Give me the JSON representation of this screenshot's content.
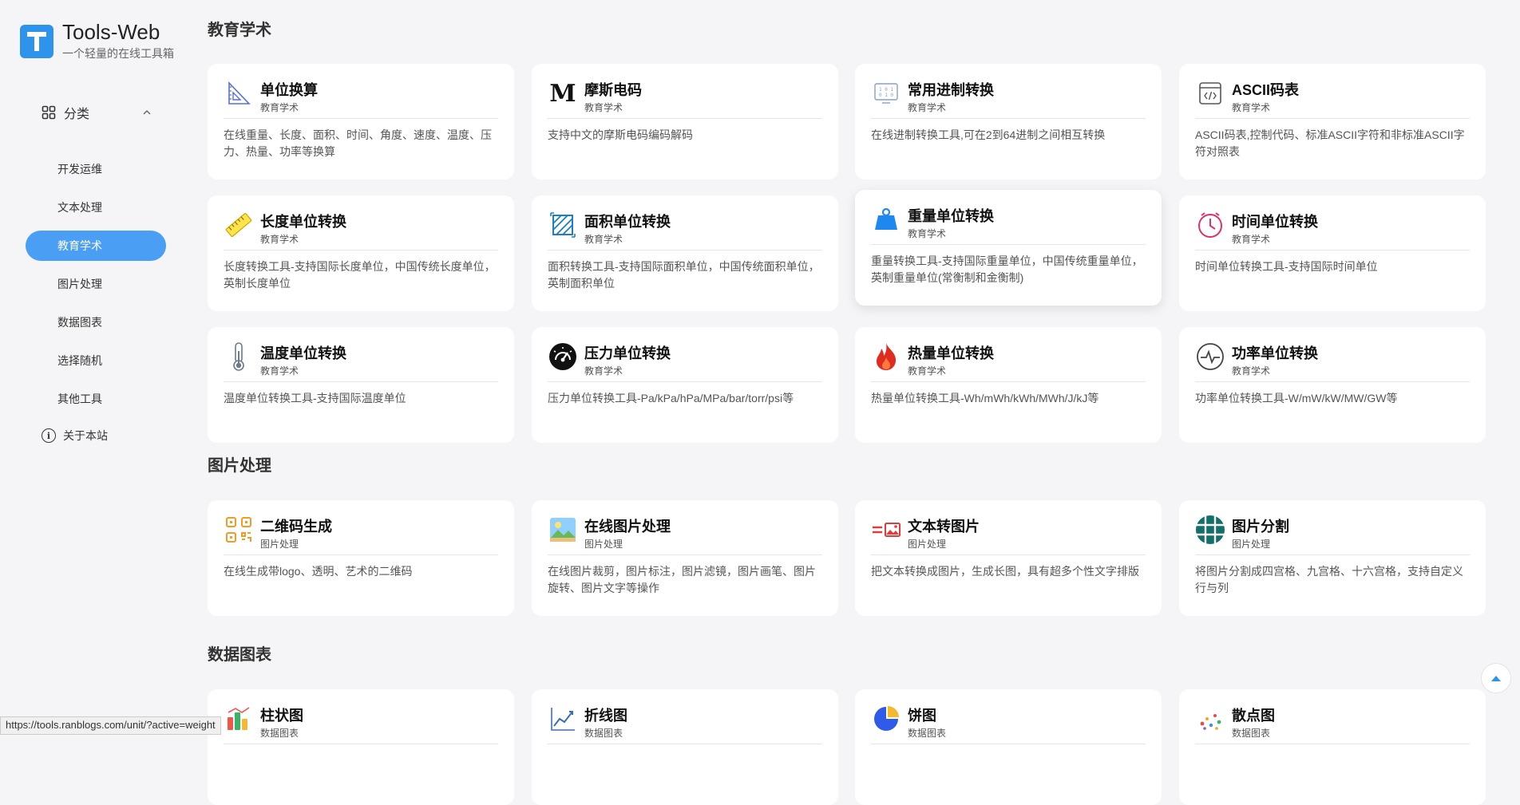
{
  "brand": {
    "name": "Tools-Web",
    "subtitle": "一个轻量的在线工具箱"
  },
  "sidebar": {
    "category_label": "分类",
    "items": [
      {
        "label": "开发运维"
      },
      {
        "label": "文本处理"
      },
      {
        "label": "教育学术",
        "active": true
      },
      {
        "label": "图片处理"
      },
      {
        "label": "数据图表"
      },
      {
        "label": "选择随机"
      },
      {
        "label": "其他工具"
      }
    ],
    "about_label": "关于本站"
  },
  "sections": [
    {
      "title": "教育学术",
      "cards": [
        {
          "title": "单位换算",
          "category": "教育学术",
          "desc": "在线重量、长度、面积、时间、角度、速度、温度、压力、热量、功率等换算",
          "icon": "ruler-triangle-icon"
        },
        {
          "title": "摩斯电码",
          "category": "教育学术",
          "desc": "支持中文的摩斯电码编码解码",
          "icon": "morse-m-icon"
        },
        {
          "title": "常用进制转换",
          "category": "教育学术",
          "desc": "在线进制转换工具,可在2到64进制之间相互转换",
          "icon": "binary-screen-icon"
        },
        {
          "title": "ASCII码表",
          "category": "教育学术",
          "desc": "ASCII码表,控制代码、标准ASCII字符和非标准ASCII字符对照表",
          "icon": "code-document-icon"
        },
        {
          "title": "长度单位转换",
          "category": "教育学术",
          "desc": "长度转换工具-支持国际长度单位，中国传统长度单位，英制长度单位",
          "icon": "ruler-icon"
        },
        {
          "title": "面积单位转换",
          "category": "教育学术",
          "desc": "面积转换工具-支持国际面积单位，中国传统面积单位，英制面积单位",
          "icon": "area-hatch-icon"
        },
        {
          "title": "重量单位转换",
          "category": "教育学术",
          "desc": "重量转换工具-支持国际重量单位，中国传统重量单位，英制重量单位(常衡制和金衡制)",
          "icon": "weight-icon"
        },
        {
          "title": "时间单位转换",
          "category": "教育学术",
          "desc": "时间单位转换工具-支持国际时间单位",
          "icon": "clock-icon"
        },
        {
          "title": "温度单位转换",
          "category": "教育学术",
          "desc": "温度单位转换工具-支持国际温度单位",
          "icon": "thermometer-icon"
        },
        {
          "title": "压力单位转换",
          "category": "教育学术",
          "desc": "压力单位转换工具-Pa/kPa/hPa/MPa/bar/torr/psi等",
          "icon": "gauge-icon"
        },
        {
          "title": "热量单位转换",
          "category": "教育学术",
          "desc": "热量单位转换工具-Wh/mWh/kWh/MWh/J/kJ等",
          "icon": "flame-icon"
        },
        {
          "title": "功率单位转换",
          "category": "教育学术",
          "desc": "功率单位转换工具-W/mW/kW/MW/GW等",
          "icon": "pulse-icon"
        }
      ]
    },
    {
      "title": "图片处理",
      "cards": [
        {
          "title": "二维码生成",
          "category": "图片处理",
          "desc": "在线生成带logo、透明、艺术的二维码",
          "icon": "qrcode-icon"
        },
        {
          "title": "在线图片处理",
          "category": "图片处理",
          "desc": "在线图片裁剪，图片标注，图片滤镜，图片画笔、图片旋转、图片文字等操作",
          "icon": "landscape-image-icon"
        },
        {
          "title": "文本转图片",
          "category": "图片处理",
          "desc": "把文本转换成图片，生成长图，具有超多个性文字排版",
          "icon": "text-to-image-icon"
        },
        {
          "title": "图片分割",
          "category": "图片处理",
          "desc": "将图片分割成四宫格、九宫格、十六宫格，支持自定义行与列",
          "icon": "grid-split-icon"
        }
      ]
    },
    {
      "title": "数据图表",
      "cards": [
        {
          "title": "柱状图",
          "category": "数据图表",
          "icon": "bar-chart-icon"
        },
        {
          "title": "折线图",
          "category": "数据图表",
          "icon": "line-chart-icon"
        },
        {
          "title": "饼图",
          "category": "数据图表",
          "icon": "pie-chart-icon"
        },
        {
          "title": "散点图",
          "category": "数据图表",
          "icon": "scatter-chart-icon"
        }
      ]
    }
  ],
  "status_url": "https://tools.ranblogs.com/unit/?active=weight"
}
